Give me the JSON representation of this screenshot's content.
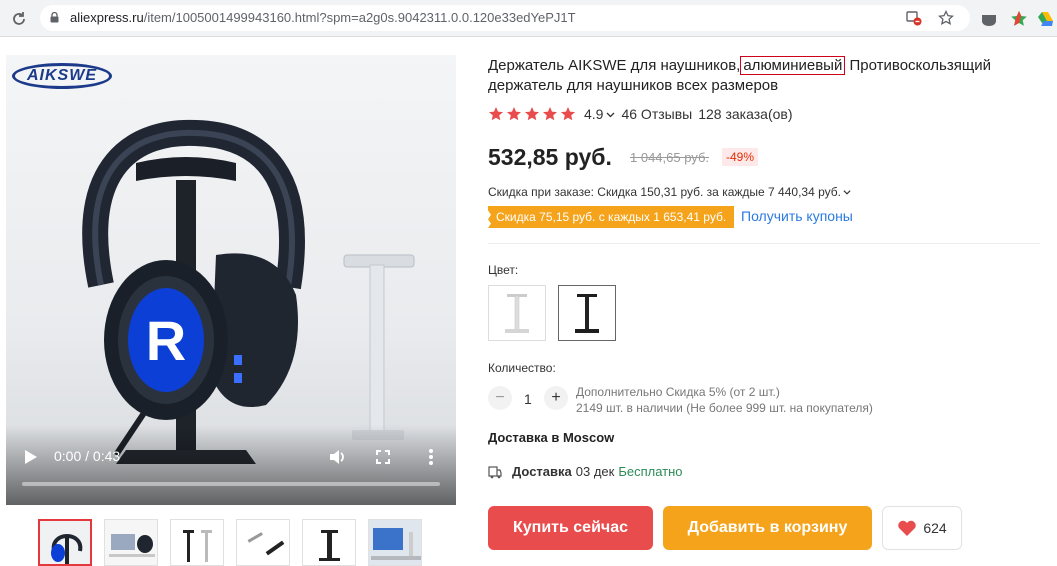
{
  "browser": {
    "url_domain": "aliexpress.ru",
    "url_path": "/item/1005001499943160.html?spm=a2g0s.9042311.0.0.120e33edYePJ1T"
  },
  "gallery": {
    "logo_text": "AIKSWE",
    "video_time": "0:00 / 0:43",
    "video_progress": 0.0,
    "thumbnail_count": 6
  },
  "product": {
    "title_before": "Держатель AIKSWE для наушников,",
    "title_highlight": "алюминиевый",
    "title_after": " Противоскользящий держатель для наушников всех размеров",
    "rating": "4.9",
    "stars": 5,
    "reviews": "46 Отзывы",
    "orders": "128 заказа(ов)",
    "price": "532,85 руб.",
    "old_price": "1 044,65 руб.",
    "discount": "-49%",
    "order_discount": "Скидка при заказе: Скидка 150,31 руб. за каждые 7 440,34 руб.",
    "coupon_badge": "Скидка 75,15 руб. с каждых 1 653,41 руб.",
    "get_coupons": "Получить купоны",
    "color_label": "Цвет:",
    "qty_label": "Количество:",
    "qty_value": "1",
    "qty_minus": "−",
    "qty_plus": "+",
    "qty_info_line1": "Дополнительно Скидка 5% (от 2 шт.)",
    "qty_info_line2": "2149 шт. в наличии (Не более 999 шт. на покупателя)",
    "delivery_to": "Доставка в Moscow",
    "delivery_label": "Доставка",
    "delivery_date": "03 дек",
    "delivery_free": "Бесплатно",
    "buy_now": "Купить сейчас",
    "add_to_cart": "Добавить в корзину",
    "wishlist_count": "624"
  },
  "colors": {
    "accent_red": "#e84c4c",
    "accent_orange": "#f5a31a",
    "link_blue": "#2a7ae2"
  }
}
